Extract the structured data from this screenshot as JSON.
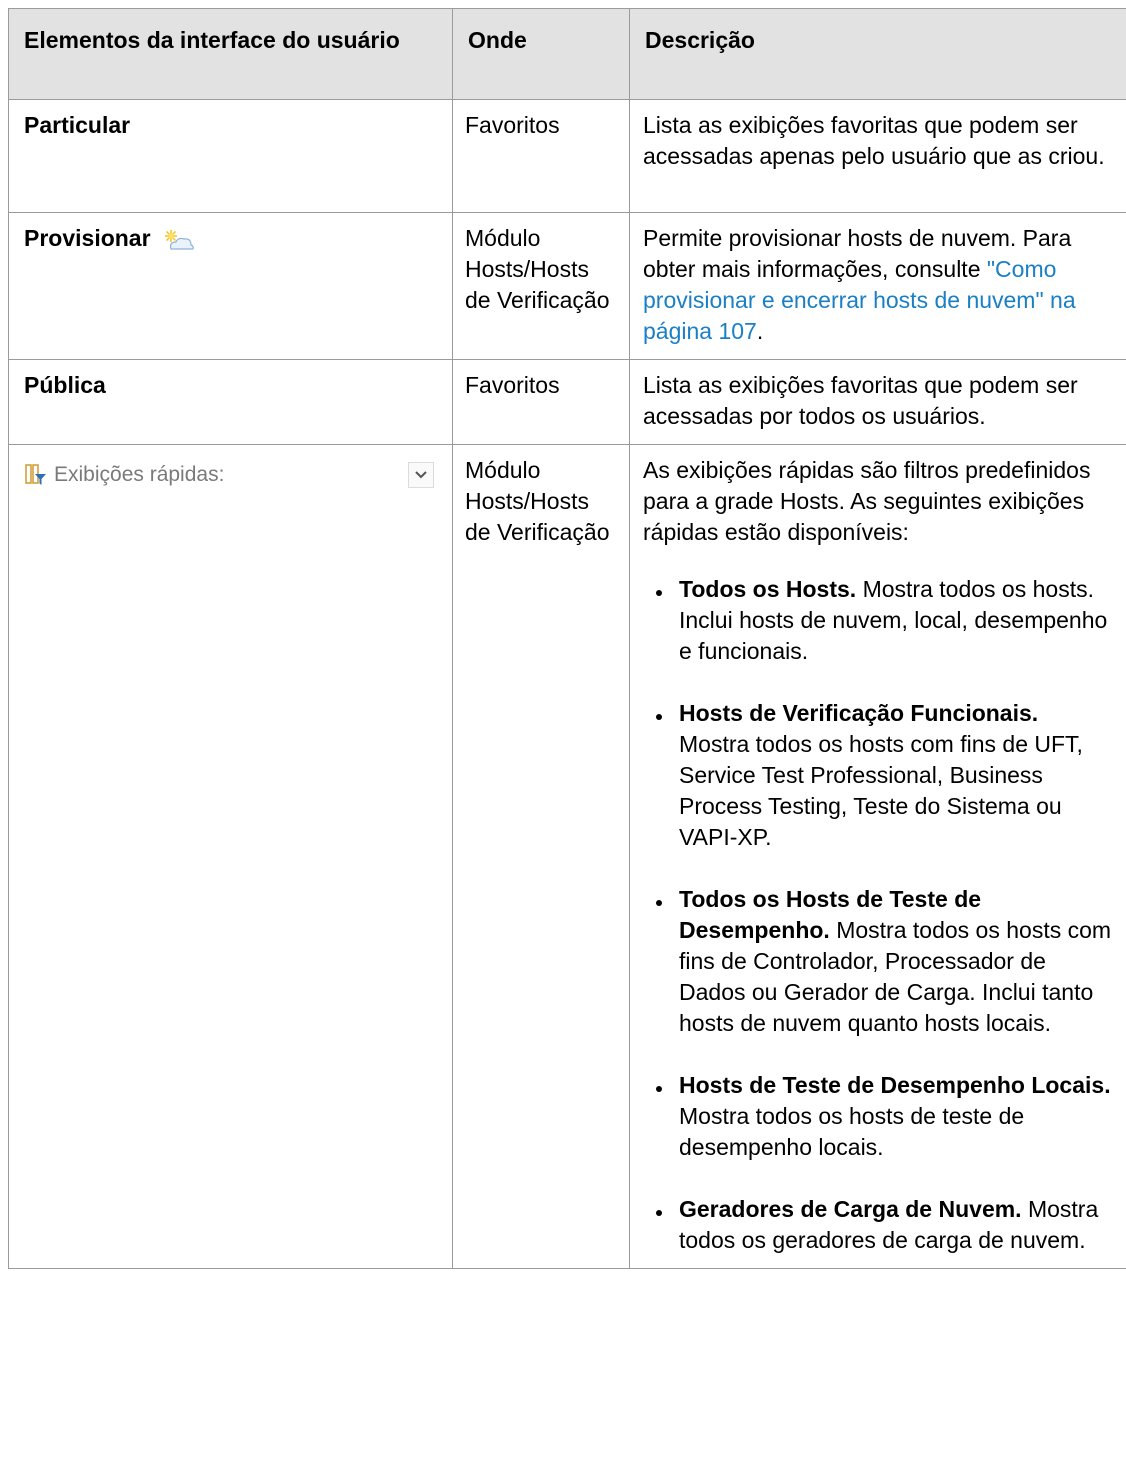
{
  "headers": {
    "col1": "Elementos da interface do usuário",
    "col2": "Onde",
    "col3": "Descrição"
  },
  "rows": {
    "particular": {
      "element": "Particular",
      "where": "Favoritos",
      "description": "Lista as exibições favoritas que podem ser acessadas apenas pelo usuário que as criou."
    },
    "provisionar": {
      "element": "Provisionar",
      "icon": "cloud-provision-icon",
      "where": "Módulo Hosts/Hosts de Verificação",
      "description_before": "Permite provisionar hosts de nuvem. Para obter mais informações, consulte ",
      "link_text": "\"Como provisionar e encerrar hosts de nuvem\" na página 107",
      "description_after": "."
    },
    "publica": {
      "element": "Pública",
      "where": "Favoritos",
      "description": "Lista as exibições favoritas que podem ser acessadas por todos os usuários."
    },
    "quick_views": {
      "element_label": "Exibições rápidas:",
      "icon": "filter-grid-icon",
      "dropdown_icon": "chevron-down-icon",
      "where": "Módulo Hosts/Hosts de Verificação",
      "intro": "As exibições rápidas são filtros predefinidos para a grade Hosts. As seguintes exibições rápidas estão disponíveis:",
      "items": [
        {
          "title": "Todos os Hosts.",
          "text": " Mostra todos os hosts. Inclui hosts de nuvem, local, desempenho e funcionais."
        },
        {
          "title": "Hosts de Verificação Funcionais.",
          "text": " Mostra todos os hosts com fins de UFT, Service Test Professional, Business Process Testing, Teste do Sistema ou VAPI-XP."
        },
        {
          "title": "Todos os Hosts de Teste de Desempenho.",
          "text": " Mostra todos os hosts com fins de Controlador, Processador de Dados ou Gerador de Carga. Inclui tanto hosts de nuvem quanto hosts locais."
        },
        {
          "title": "Hosts de Teste de Desempenho Locais.",
          "text": " Mostra todos os hosts de teste de desempenho locais."
        },
        {
          "title": "Geradores de Carga de Nuvem.",
          "text": " Mostra todos os geradores de carga de nuvem."
        }
      ]
    }
  },
  "colors": {
    "header_bg": "#e2e2e2",
    "border": "#9b9b9b",
    "link": "#1a7fc4"
  }
}
